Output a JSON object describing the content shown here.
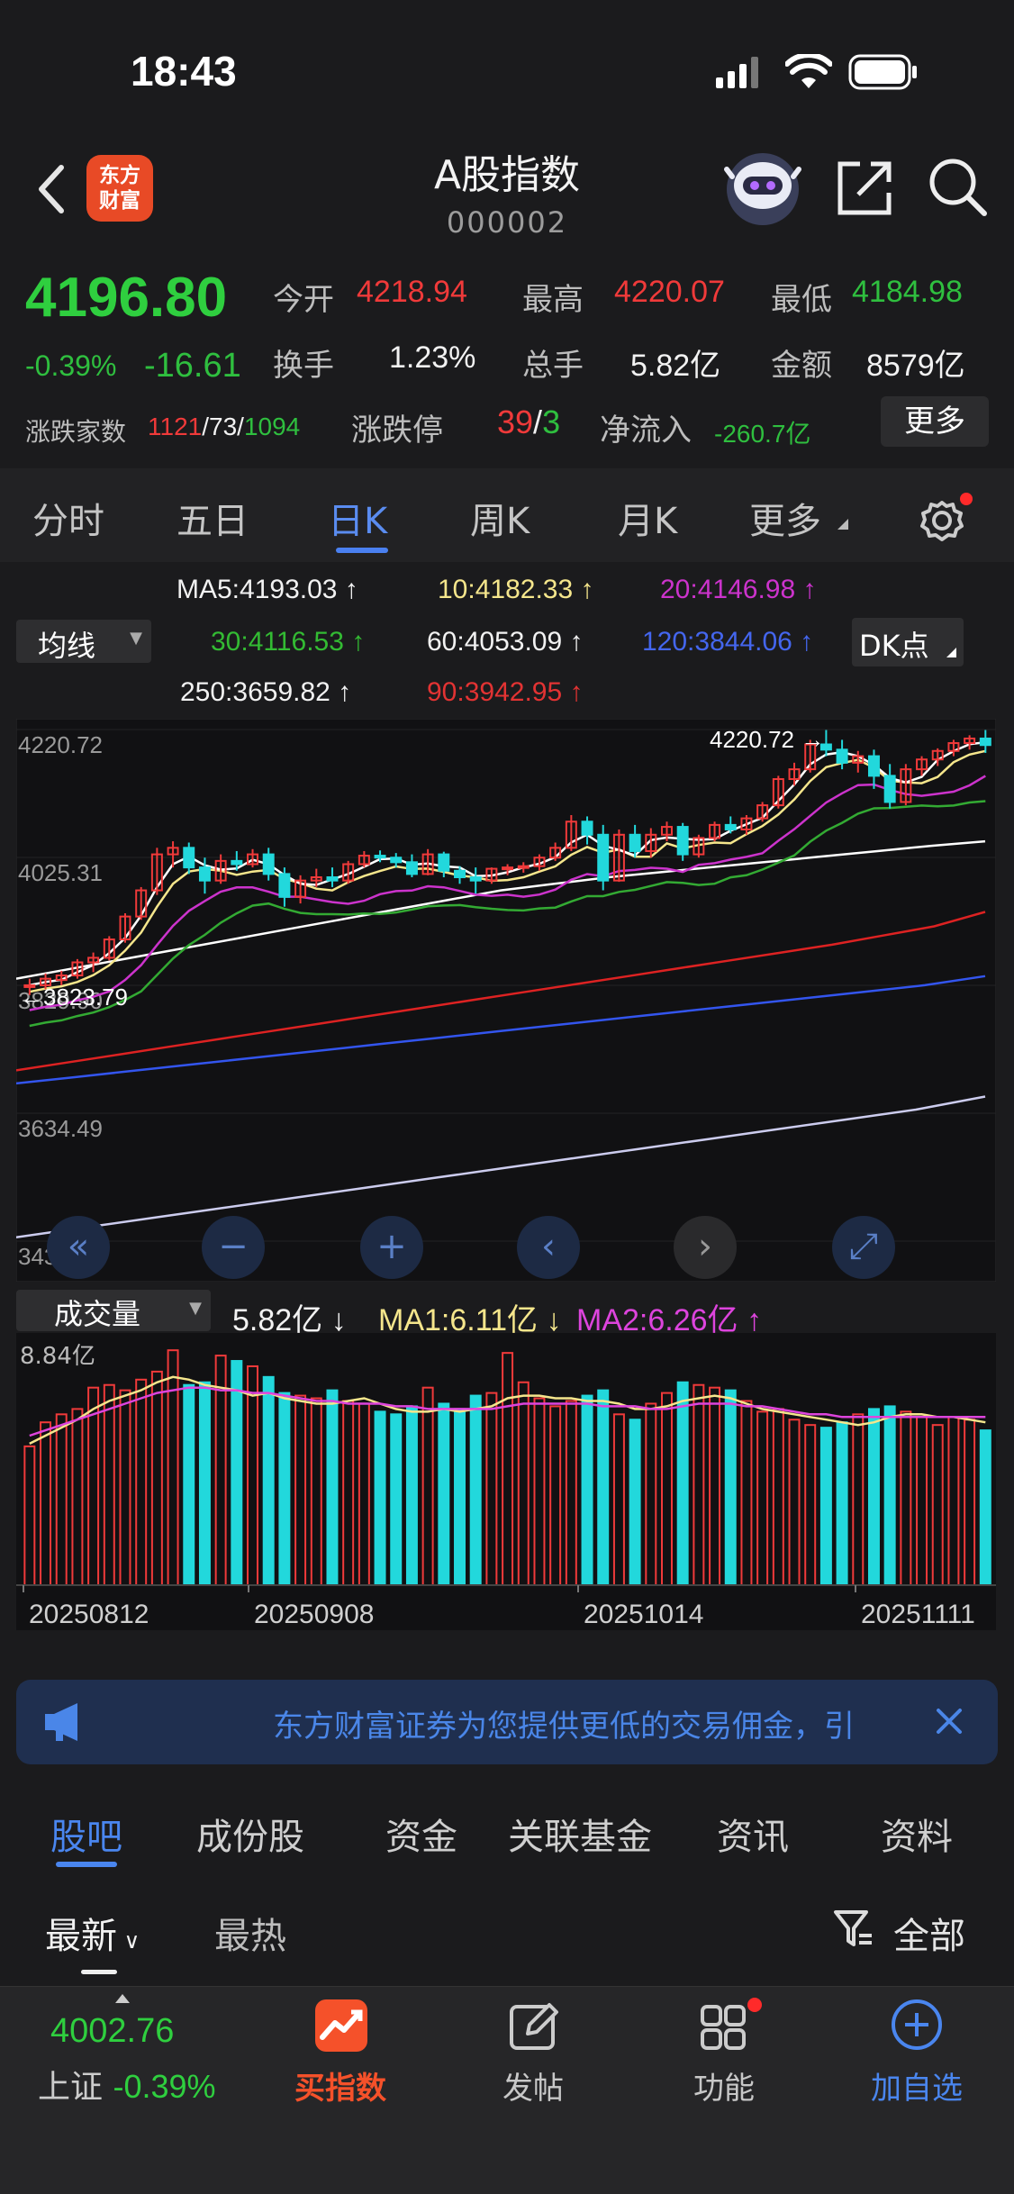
{
  "status_bar": {
    "time": "18:43"
  },
  "header": {
    "logo": "东方\n财富",
    "title": "A股指数",
    "code": "000002"
  },
  "quote": {
    "price": "4196.80",
    "change_pct": "-0.39%",
    "change": "-16.61",
    "open_label": "今开",
    "open": "4218.94",
    "high_label": "最高",
    "high": "4220.07",
    "low_label": "最低",
    "low": "4184.98",
    "turnover_label": "换手",
    "turnover": "1.23%",
    "volume_label": "总手",
    "volume": "5.82亿",
    "amount_label": "金额",
    "amount": "8579亿",
    "breadth_label": "涨跌家数",
    "breadth_up": "1121",
    "breadth_flat": "73",
    "breadth_down": "1094",
    "limit_label": "涨跌停",
    "limit_up": "39",
    "limit_down": "3",
    "netflow_label": "净流入",
    "netflow": "-260.7亿",
    "more_label": "更多"
  },
  "period_tabs": {
    "items": [
      "分时",
      "五日",
      "日K",
      "周K",
      "月K",
      "更多"
    ],
    "active": "日K"
  },
  "ma_legend": {
    "selector": "均线",
    "dk_button": "DK点",
    "ma5": "MA5:4193.03",
    "ma10": "10:4182.33",
    "ma20": "20:4146.98",
    "ma30": "30:4116.53",
    "ma60": "60:4053.09",
    "ma120": "120:3844.06",
    "ma250": "250:3659.82",
    "ma90": "90:3942.95"
  },
  "colors": {
    "up": "#f03a3a",
    "down": "#22d8dc",
    "ma5": "#ffffff",
    "ma10": "#f5e68c",
    "ma20": "#cc33cc",
    "ma30": "#33aa33",
    "ma60": "#ffffff",
    "ma90": "#dd2222",
    "ma120": "#3355ee",
    "ma250": "#ccccee",
    "accent": "#4a86ef"
  },
  "chart_data": [
    {
      "type": "candlestick",
      "y_ticks": [
        "4220.72",
        "4025.31",
        "3829.90",
        "3634.49",
        "3439.09"
      ],
      "ylim": [
        3439.09,
        4220.72
      ],
      "max_label": "4220.72",
      "min_label": "3823.79",
      "x_labels": [
        "20250812",
        "20250908",
        "20251014",
        "20251111"
      ],
      "ohlc": [
        [
          3828,
          3840,
          3815,
          3830
        ],
        [
          3830,
          3848,
          3824,
          3840
        ],
        [
          3838,
          3852,
          3830,
          3845
        ],
        [
          3845,
          3870,
          3840,
          3865
        ],
        [
          3865,
          3880,
          3850,
          3872
        ],
        [
          3872,
          3905,
          3868,
          3900
        ],
        [
          3900,
          3940,
          3895,
          3935
        ],
        [
          3935,
          3980,
          3930,
          3975
        ],
        [
          3975,
          4040,
          3968,
          4030
        ],
        [
          4030,
          4050,
          4010,
          4040
        ],
        [
          4040,
          4048,
          4000,
          4010
        ],
        [
          4010,
          4025,
          3970,
          3990
        ],
        [
          3990,
          4030,
          3985,
          4020
        ],
        [
          4020,
          4035,
          4005,
          4015
        ],
        [
          4015,
          4038,
          4010,
          4030
        ],
        [
          4030,
          4040,
          3990,
          4000
        ],
        [
          4000,
          4010,
          3950,
          3965
        ],
        [
          3965,
          3998,
          3955,
          3990
        ],
        [
          3990,
          4008,
          3980,
          3995
        ],
        [
          3995,
          4010,
          3980,
          3990
        ],
        [
          3990,
          4020,
          3985,
          4015
        ],
        [
          4015,
          4035,
          4010,
          4028
        ],
        [
          4028,
          4036,
          4018,
          4025
        ],
        [
          4025,
          4032,
          4010,
          4018
        ],
        [
          4018,
          4030,
          3995,
          4000
        ],
        [
          4000,
          4038,
          3998,
          4030
        ],
        [
          4030,
          4034,
          3995,
          4005
        ],
        [
          4005,
          4012,
          3985,
          3995
        ],
        [
          3995,
          4010,
          3970,
          3990
        ],
        [
          3990,
          4010,
          3985,
          4008
        ],
        [
          4008,
          4015,
          3998,
          4010
        ],
        [
          4010,
          4018,
          4002,
          4012
        ],
        [
          4012,
          4030,
          4005,
          4025
        ],
        [
          4025,
          4048,
          4020,
          4040
        ],
        [
          4040,
          4090,
          4035,
          4080
        ],
        [
          4080,
          4088,
          4045,
          4060
        ],
        [
          4060,
          4075,
          3975,
          3990
        ],
        [
          3990,
          4068,
          3988,
          4060
        ],
        [
          4060,
          4075,
          4025,
          4035
        ],
        [
          4035,
          4070,
          4025,
          4060
        ],
        [
          4060,
          4080,
          4050,
          4072
        ],
        [
          4072,
          4078,
          4020,
          4030
        ],
        [
          4030,
          4060,
          4025,
          4055
        ],
        [
          4055,
          4080,
          4050,
          4075
        ],
        [
          4075,
          4088,
          4062,
          4068
        ],
        [
          4068,
          4090,
          4060,
          4085
        ],
        [
          4085,
          4110,
          4080,
          4105
        ],
        [
          4105,
          4150,
          4100,
          4145
        ],
        [
          4145,
          4170,
          4135,
          4160
        ],
        [
          4160,
          4205,
          4155,
          4198
        ],
        [
          4198,
          4220,
          4180,
          4190
        ],
        [
          4190,
          4205,
          4160,
          4170
        ],
        [
          4170,
          4188,
          4155,
          4180
        ],
        [
          4180,
          4190,
          4130,
          4150
        ],
        [
          4150,
          4168,
          4100,
          4110
        ],
        [
          4110,
          4168,
          4105,
          4160
        ],
        [
          4160,
          4180,
          4150,
          4175
        ],
        [
          4175,
          4192,
          4165,
          4188
        ],
        [
          4188,
          4205,
          4180,
          4200
        ],
        [
          4200,
          4212,
          4190,
          4207
        ],
        [
          4207,
          4220,
          4185,
          4197
        ]
      ]
    },
    {
      "type": "bar",
      "title": "成交量",
      "current": "5.82亿",
      "ma1": "MA1:6.11亿",
      "ma2": "MA2:6.26亿",
      "y_max_label": "8.84亿",
      "ylim": [
        0,
        8.84
      ],
      "values": [
        5.2,
        6.1,
        6.4,
        6.6,
        7.4,
        7.5,
        7.3,
        7.7,
        8.0,
        8.8,
        7.5,
        7.6,
        8.6,
        8.4,
        8.2,
        7.8,
        7.2,
        7.1,
        7.0,
        7.3,
        6.9,
        6.8,
        6.5,
        6.4,
        6.7,
        7.4,
        6.8,
        6.6,
        7.1,
        7.2,
        8.7,
        7.6,
        7.0,
        6.7,
        6.9,
        7.1,
        7.3,
        6.4,
        6.2,
        6.8,
        7.2,
        7.6,
        7.5,
        7.4,
        7.3,
        6.9,
        6.5,
        6.6,
        6.2,
        6.0,
        5.9,
        6.1,
        6.4,
        6.6,
        6.7,
        6.5,
        6.3,
        6.0,
        6.3,
        6.2,
        5.8
      ],
      "ma1_values": [
        5.3,
        5.6,
        5.9,
        6.2,
        6.6,
        6.9,
        7.1,
        7.3,
        7.6,
        7.8,
        7.7,
        7.5,
        7.4,
        7.3,
        7.1,
        7.2,
        7.0,
        6.9,
        6.8,
        6.8,
        6.9,
        7.0,
        6.8,
        6.6,
        6.5,
        6.5,
        6.6,
        6.5,
        6.6,
        6.7,
        7.0,
        7.1,
        7.1,
        7.0,
        7.0,
        6.9,
        6.9,
        6.8,
        6.6,
        6.6,
        6.7,
        6.9,
        7.0,
        7.1,
        7.0,
        6.8,
        6.6,
        6.5,
        6.4,
        6.3,
        6.2,
        6.1,
        6.0,
        6.1,
        6.3,
        6.4,
        6.4,
        6.3,
        6.3,
        6.2,
        6.1
      ],
      "ma2_values": [
        5.6,
        5.8,
        6.0,
        6.2,
        6.4,
        6.6,
        6.8,
        7.0,
        7.2,
        7.3,
        7.4,
        7.4,
        7.3,
        7.3,
        7.2,
        7.2,
        7.1,
        7.0,
        6.9,
        6.9,
        6.8,
        6.8,
        6.8,
        6.7,
        6.7,
        6.6,
        6.6,
        6.6,
        6.6,
        6.6,
        6.7,
        6.8,
        6.8,
        6.8,
        6.8,
        6.8,
        6.7,
        6.7,
        6.7,
        6.6,
        6.6,
        6.7,
        6.8,
        6.8,
        6.8,
        6.7,
        6.7,
        6.6,
        6.5,
        6.4,
        6.4,
        6.3,
        6.3,
        6.3,
        6.3,
        6.3,
        6.3,
        6.3,
        6.3,
        6.3,
        6.3
      ]
    }
  ],
  "ma_lines": {
    "ma60": [
      3840,
      3855,
      3870,
      3885,
      3900,
      3915,
      3930,
      3945,
      3960,
      3975,
      3985,
      3995,
      4003,
      4011,
      4019,
      4027,
      4035,
      4043,
      4050
    ],
    "ma90": [
      3700,
      3712,
      3724,
      3736,
      3748,
      3760,
      3772,
      3784,
      3796,
      3808,
      3820,
      3832,
      3844,
      3856,
      3868,
      3880,
      3892,
      3906,
      3920,
      3942
    ],
    "ma120": [
      3680,
      3690,
      3700,
      3710,
      3720,
      3730,
      3740,
      3750,
      3760,
      3770,
      3780,
      3790,
      3800,
      3810,
      3820,
      3830,
      3844
    ],
    "ma250": [
      3445,
      3460,
      3475,
      3490,
      3505,
      3520,
      3535,
      3550,
      3565,
      3580,
      3595,
      3610,
      3625,
      3640,
      3660
    ]
  },
  "banner": {
    "text": "东方财富证券为您提供更低的交易佣金，引"
  },
  "community_tabs": {
    "items": [
      "股吧",
      "成份股",
      "资金",
      "关联基金",
      "资讯",
      "资料"
    ],
    "active": "股吧",
    "sort_latest": "最新",
    "sort_hot": "最热",
    "filter": "全部"
  },
  "bottom_bar": {
    "index_value": "4002.76",
    "index_name": "上证",
    "index_change": "-0.39%",
    "buy_index": "买指数",
    "post": "发帖",
    "functions": "功能",
    "add_watch": "加自选"
  }
}
